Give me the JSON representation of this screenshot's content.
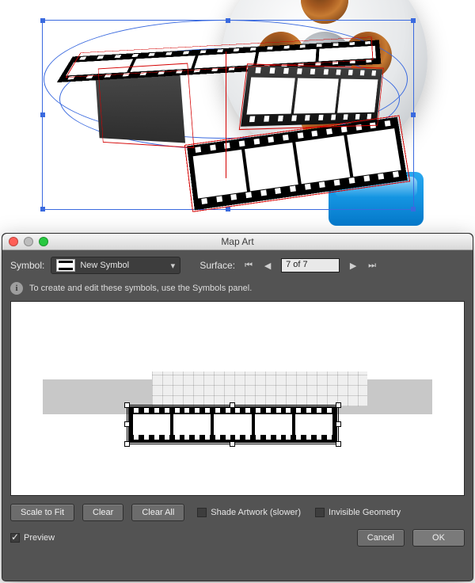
{
  "preview": {
    "image_label": "3D film strip mapped onto ellipse with film reel behind",
    "selection_visible": true
  },
  "dialog": {
    "title": "Map Art",
    "traffic_colors": {
      "close": "#ff5f57",
      "minimize": "#b9b9b9",
      "zoom": "#28c840"
    },
    "symbol_label": "Symbol:",
    "symbol_name": "New Symbol",
    "surface_label": "Surface:",
    "surface_value": "7 of 7",
    "hint": "To create and edit these symbols, use the Symbols panel.",
    "buttons": {
      "scale_to_fit": "Scale to Fit",
      "clear": "Clear",
      "clear_all": "Clear All",
      "cancel": "Cancel",
      "ok": "OK"
    },
    "checkboxes": {
      "shade_label": "Shade Artwork (slower)",
      "shade_checked": false,
      "invisible_label": "Invisible Geometry",
      "invisible_checked": false,
      "preview_label": "Preview",
      "preview_checked": true
    },
    "nav_icons": {
      "first": "⏮",
      "prev": "◀",
      "next": "▶",
      "last": "⏭"
    }
  }
}
